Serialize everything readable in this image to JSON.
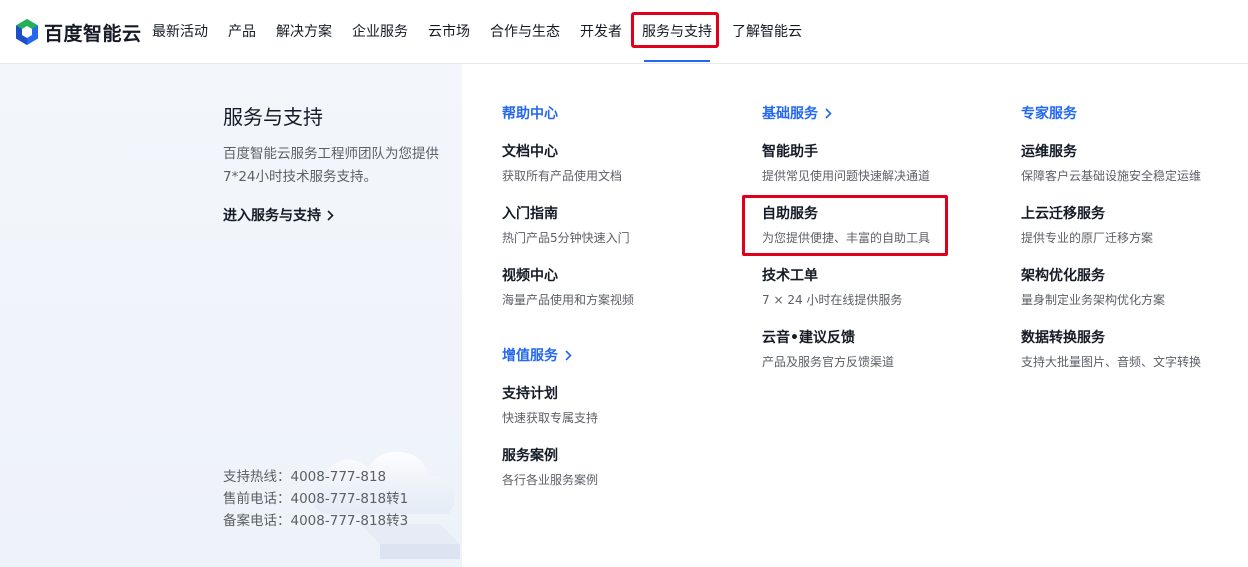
{
  "brand": {
    "name": "百度智能云",
    "colors": {
      "blue": "#2468f2",
      "green": "#20b15a",
      "highlight": "#e0001b"
    }
  },
  "nav": {
    "items": [
      "最新活动",
      "产品",
      "解决方案",
      "企业服务",
      "云市场",
      "合作与生态",
      "开发者",
      "服务与支持",
      "了解智能云"
    ],
    "active": "服务与支持"
  },
  "intro": {
    "title": "服务与支持",
    "desc": "百度智能云服务工程师团队为您提供7*24小时技术服务支持。",
    "link": "进入服务与支持",
    "hotlines": [
      "支持热线：4008-777-818",
      "售前电话：4008-777-818转1",
      "备案电话：4008-777-818转3"
    ]
  },
  "columns": {
    "help": {
      "title": "帮助中心",
      "items": [
        {
          "title": "文档中心",
          "desc": "获取所有产品使用文档"
        },
        {
          "title": "入门指南",
          "desc": "热门产品5分钟快速入门"
        },
        {
          "title": "视频中心",
          "desc": "海量产品使用和方案视频"
        }
      ]
    },
    "value_added": {
      "title": "增值服务",
      "items": [
        {
          "title": "支持计划",
          "desc": "快速获取专属支持"
        },
        {
          "title": "服务案例",
          "desc": "各行各业服务案例"
        }
      ]
    },
    "basic": {
      "title": "基础服务",
      "items": [
        {
          "title": "智能助手",
          "desc": "提供常见使用问题快速解决通道"
        },
        {
          "title": "自助服务",
          "desc": "为您提供便捷、丰富的自助工具"
        },
        {
          "title": "技术工单",
          "desc": "7 × 24 小时在线提供服务"
        },
        {
          "title": "云音•建议反馈",
          "desc": "产品及服务官方反馈渠道"
        }
      ]
    },
    "expert": {
      "title": "专家服务",
      "items": [
        {
          "title": "运维服务",
          "desc": "保障客户云基础设施安全稳定运维"
        },
        {
          "title": "上云迁移服务",
          "desc": "提供专业的原厂迁移方案"
        },
        {
          "title": "架构优化服务",
          "desc": "量身制定业务架构优化方案"
        },
        {
          "title": "数据转换服务",
          "desc": "支持大批量图片、音频、文字转换"
        }
      ]
    }
  },
  "icons": {
    "logo": "baidu-cloud-logo-icon",
    "chevron": "chevron-right-icon",
    "decoration": "cloud-illustration-icon"
  }
}
